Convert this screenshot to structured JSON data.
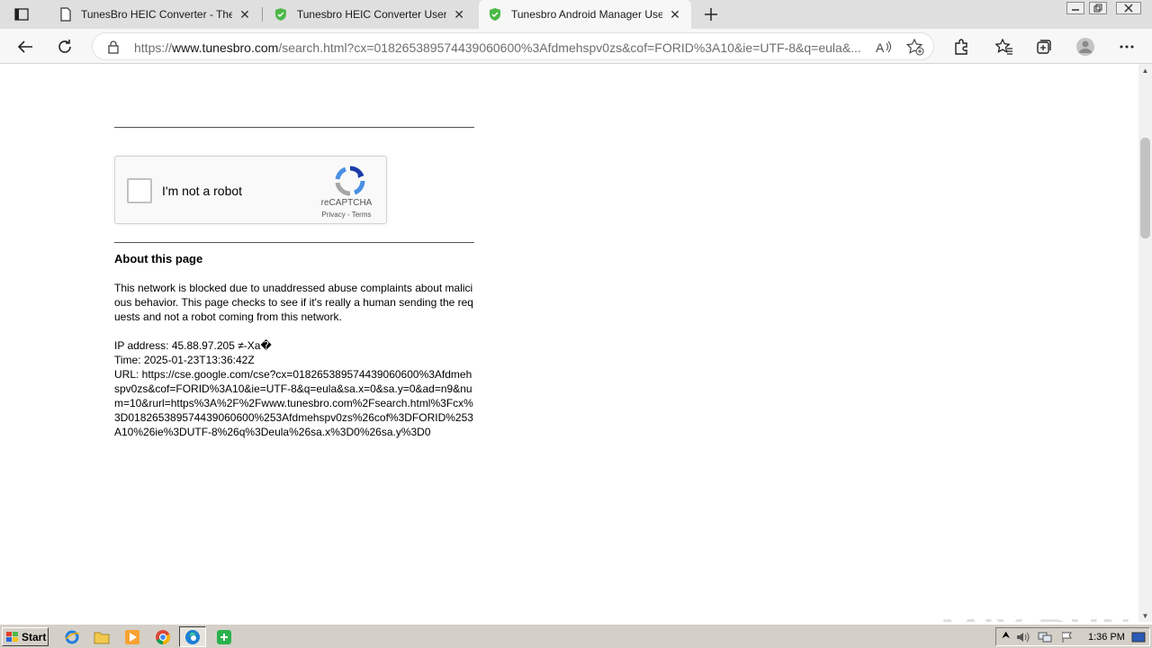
{
  "browser": {
    "tabs": [
      {
        "title": "TunesBro HEIC Converter - The",
        "active": false
      },
      {
        "title": "Tunesbro HEIC Converter User G",
        "active": false
      },
      {
        "title": "Tunesbro Android Manager Use",
        "active": true
      }
    ],
    "url_prefix": "https://",
    "url_domain": "www.tunesbro.com",
    "url_rest": "/search.html?cx=018265389574439060600%3Afdmehspv0zs&cof=FORID%3A10&ie=UTF-8&q=eula&..."
  },
  "captcha": {
    "label": "I'm not a robot",
    "brand": "reCAPTCHA",
    "links": "Privacy - Terms"
  },
  "about": {
    "heading": "About this page",
    "description": "This network is blocked due to unaddressed abuse complaints about malicious behavior. This page checks to see if it's really a human sending the requests and not a robot coming from this network.",
    "ip_line": "IP address: 45.88.97.205 ≠-Xa�",
    "time_line": "Time: 2025-01-23T13:36:42Z",
    "url_line": "URL: https://cse.google.com/cse?cx=018265389574439060600%3Afdmehspv0zs&cof=FORID%3A10&ie=UTF-8&q=eula&sa.x=0&sa.y=0&ad=n9&num=10&rurl=https%3A%2F%2Fwww.tunesbro.com%2Fsearch.html%3Fcx%3D018265389574439060600%253Afdmehspv0zs%26cof%3DFORID%253A10%26ie%3DUTF-8%26q%3Deula%26sa.x%3D0%26sa.y%3D0"
  },
  "watermark": "ANY RUN",
  "taskbar": {
    "start_label": "Start",
    "clock": "1:36 PM"
  }
}
